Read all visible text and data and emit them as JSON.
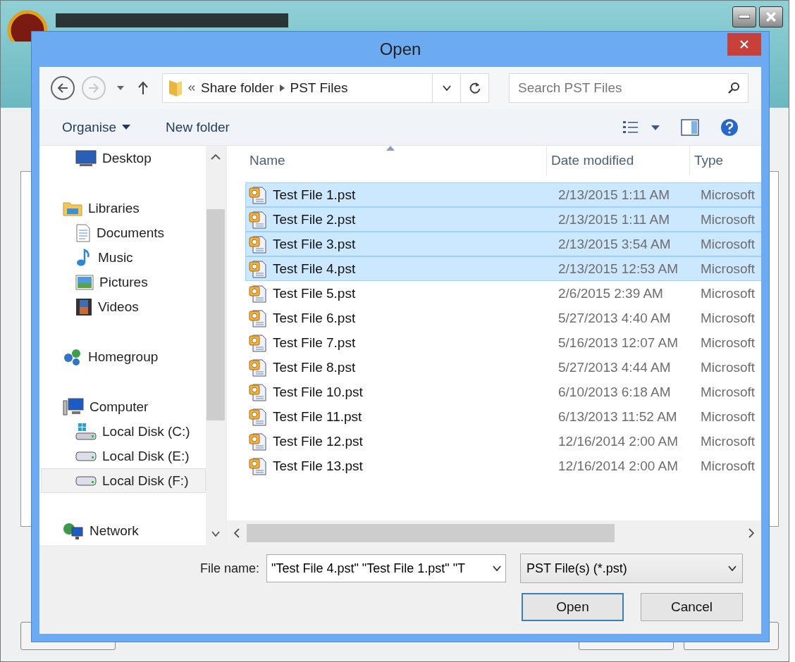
{
  "dialog": {
    "title": "Open",
    "address": {
      "path": [
        "Share folder",
        "PST Files"
      ]
    },
    "search": {
      "placeholder": "Search PST Files"
    },
    "toolbar": {
      "organise": "Organise",
      "new_folder": "New folder"
    },
    "nav_tree": [
      {
        "children": [
          {
            "label": "Desktop",
            "selected": false
          }
        ]
      },
      {
        "label": "Libraries",
        "selected": false,
        "children": [
          {
            "label": "Documents",
            "selected": false
          },
          {
            "label": "Music",
            "selected": false
          },
          {
            "label": "Pictures",
            "selected": false
          },
          {
            "label": "Videos",
            "selected": false
          }
        ]
      },
      {
        "label": "Homegroup",
        "selected": false
      },
      {
        "label": "Computer",
        "selected": false,
        "children": [
          {
            "label": "Local Disk (C:)",
            "selected": false
          },
          {
            "label": "Local Disk (E:)",
            "selected": false
          },
          {
            "label": "Local Disk (F:)",
            "selected": true
          }
        ]
      },
      {
        "label": "Network",
        "selected": false
      }
    ],
    "columns": [
      {
        "label": "Name",
        "sorted": true
      },
      {
        "label": "Date modified",
        "sorted": false
      },
      {
        "label": "Type",
        "sorted": false
      }
    ],
    "files": [
      {
        "name": "Test File 1.pst",
        "date": "2/13/2015 1:11 AM",
        "type": "Microsoft",
        "selected": true
      },
      {
        "name": "Test File 2.pst",
        "date": "2/13/2015 1:11 AM",
        "type": "Microsoft",
        "selected": true
      },
      {
        "name": "Test File 3.pst",
        "date": "2/13/2015 3:54 AM",
        "type": "Microsoft",
        "selected": true
      },
      {
        "name": "Test File 4.pst",
        "date": "2/13/2015 12:53 AM",
        "type": "Microsoft",
        "selected": true
      },
      {
        "name": "Test File 5.pst",
        "date": "2/6/2015 2:39 AM",
        "type": "Microsoft",
        "selected": false
      },
      {
        "name": "Test File 6.pst",
        "date": "5/27/2013 4:40 AM",
        "type": "Microsoft",
        "selected": false
      },
      {
        "name": "Test File 7.pst",
        "date": "5/16/2013 12:07 AM",
        "type": "Microsoft",
        "selected": false
      },
      {
        "name": "Test File 8.pst",
        "date": "5/27/2013 4:44 AM",
        "type": "Microsoft",
        "selected": false
      },
      {
        "name": "Test File 10.pst",
        "date": "6/10/2013 6:18 AM",
        "type": "Microsoft",
        "selected": false
      },
      {
        "name": "Test File 11.pst",
        "date": "6/13/2013 11:52 AM",
        "type": "Microsoft",
        "selected": false
      },
      {
        "name": "Test File 12.pst",
        "date": "12/16/2014 2:00 AM",
        "type": "Microsoft",
        "selected": false
      },
      {
        "name": "Test File 13.pst",
        "date": "12/16/2014 2:00 AM",
        "type": "Microsoft",
        "selected": false
      }
    ],
    "file_name": {
      "label": "File name:",
      "value": "\"Test File 4.pst\" \"Test File 1.pst\" \"T"
    },
    "file_type": {
      "value": "PST File(s) (*.pst)"
    },
    "buttons": [
      {
        "label": "Open",
        "default": true
      },
      {
        "label": "Cancel",
        "default": false
      }
    ]
  }
}
